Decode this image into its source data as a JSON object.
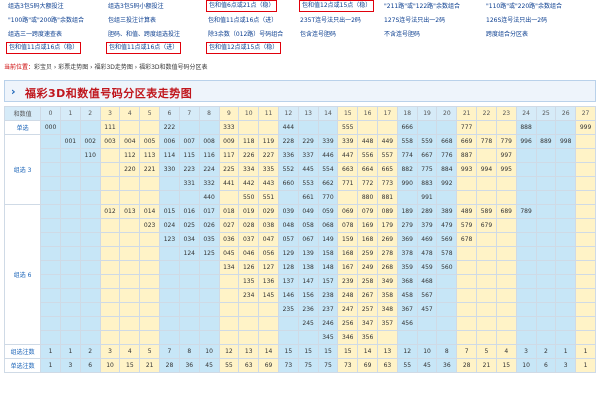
{
  "links": {
    "row1": [
      "组选3包5码大额投注",
      "组选3包5码小额投注",
      "包和值6点或21点（稳）",
      "包和值12点或15点（稳）",
      "\"211路\"或\"122路\"余数组合",
      "\"110路\"或\"220路\"余数组合"
    ],
    "row2": [
      "\"100路\"或\"200路\"余数组合",
      "包组三投注计算表",
      "包和值11点或16点（进）",
      "235T连号法只出一2码",
      "127S连号法只出一2码",
      "126S连号法只出一2码"
    ],
    "row3": [
      "组选三一跨度速查表",
      "胆码、和值、跨度组选投注",
      "除3余数（012路）号码组合",
      "包含连号胆码",
      "不含连号胆码",
      "跨度组合分区表"
    ],
    "row4": [
      "包和值11点或16点（稳）",
      "包和值11点或16点（进）",
      "包和值12点或15点（稳）"
    ]
  },
  "breadcrumb": {
    "label": "当前位置：",
    "path": "彩宝贝 › 彩票走势图 › 福彩3D走势图 › 福彩3D和数值号码分区表"
  },
  "title": "福彩3D和数值号码分区表走势图",
  "table": {
    "header_label": "和数值",
    "sums": [
      "0",
      "1",
      "2",
      "3",
      "4",
      "5",
      "6",
      "7",
      "8",
      "9",
      "10",
      "11",
      "12",
      "13",
      "14",
      "15",
      "16",
      "17",
      "18",
      "19",
      "20",
      "21",
      "22",
      "23",
      "24",
      "25",
      "26",
      "27"
    ],
    "danxuan_label": "单选",
    "danxuan": [
      "000",
      "",
      "",
      "111",
      "",
      "",
      "222",
      "",
      "",
      "333",
      "",
      "",
      "444",
      "",
      "",
      "555",
      "",
      "",
      "666",
      "",
      "",
      "777",
      "",
      "",
      "888",
      "",
      "",
      "999"
    ],
    "group3_label": "组选 3",
    "group3": [
      [
        "",
        "001",
        "002",
        "003",
        "004",
        "005",
        "006",
        "007",
        "008",
        "009",
        "118",
        "119",
        "228",
        "229",
        "339",
        "339",
        "448",
        "449",
        "558",
        "559",
        "668",
        "669",
        "778",
        "779",
        "996",
        "889",
        "998",
        ""
      ],
      [
        "",
        "",
        "110",
        "",
        "112",
        "113",
        "114",
        "115",
        "116",
        "117",
        "226",
        "227",
        "336",
        "337",
        "446",
        "447",
        "556",
        "557",
        "774",
        "667",
        "776",
        "887",
        "",
        "997",
        "",
        "",
        "",
        ""
      ],
      [
        "",
        "",
        "",
        "",
        "220",
        "221",
        "330",
        "223",
        "224",
        "225",
        "334",
        "335",
        "552",
        "445",
        "554",
        "663",
        "664",
        "665",
        "882",
        "775",
        "884",
        "993",
        "994",
        "995",
        "",
        "",
        "",
        ""
      ],
      [
        "",
        "",
        "",
        "",
        "",
        "",
        "",
        "331",
        "332",
        "441",
        "442",
        "443",
        "660",
        "553",
        "662",
        "771",
        "772",
        "773",
        "990",
        "883",
        "992",
        "",
        "",
        "",
        "",
        "",
        "",
        ""
      ],
      [
        "",
        "",
        "",
        "",
        "",
        "",
        "",
        "",
        "440",
        "",
        "550",
        "551",
        "",
        "661",
        "770",
        "",
        "880",
        "881",
        "",
        "991",
        "",
        "",
        "",
        "",
        "",
        "",
        "",
        ""
      ]
    ],
    "group6_label": "组选 6",
    "group6": [
      [
        "",
        "",
        "",
        "012",
        "013",
        "014",
        "015",
        "016",
        "017",
        "018",
        "019",
        "029",
        "039",
        "049",
        "059",
        "069",
        "079",
        "089",
        "189",
        "289",
        "389",
        "489",
        "589",
        "689",
        "789",
        "",
        "",
        ""
      ],
      [
        "",
        "",
        "",
        "",
        "",
        "023",
        "024",
        "025",
        "026",
        "027",
        "028",
        "038",
        "048",
        "058",
        "068",
        "078",
        "169",
        "179",
        "279",
        "379",
        "479",
        "579",
        "679",
        "",
        "",
        "",
        "",
        ""
      ],
      [
        "",
        "",
        "",
        "",
        "",
        "",
        "123",
        "034",
        "035",
        "036",
        "037",
        "047",
        "057",
        "067",
        "149",
        "159",
        "168",
        "269",
        "369",
        "469",
        "569",
        "678",
        "",
        "",
        "",
        "",
        "",
        ""
      ],
      [
        "",
        "",
        "",
        "",
        "",
        "",
        "",
        "124",
        "125",
        "045",
        "046",
        "056",
        "129",
        "139",
        "158",
        "168",
        "259",
        "278",
        "378",
        "478",
        "578",
        "",
        "",
        "",
        "",
        "",
        "",
        ""
      ],
      [
        "",
        "",
        "",
        "",
        "",
        "",
        "",
        "",
        "",
        "134",
        "126",
        "127",
        "128",
        "138",
        "148",
        "167",
        "249",
        "268",
        "359",
        "459",
        "560",
        "",
        "",
        "",
        "",
        "",
        "",
        ""
      ],
      [
        "",
        "",
        "",
        "",
        "",
        "",
        "",
        "",
        "",
        "",
        "135",
        "136",
        "137",
        "147",
        "157",
        "239",
        "258",
        "349",
        "368",
        "468",
        "",
        "",
        "",
        "",
        "",
        "",
        "",
        ""
      ],
      [
        "",
        "",
        "",
        "",
        "",
        "",
        "",
        "",
        "",
        "",
        "234",
        "145",
        "146",
        "156",
        "238",
        "248",
        "267",
        "358",
        "458",
        "567",
        "",
        "",
        "",
        "",
        "",
        "",
        "",
        ""
      ],
      [
        "",
        "",
        "",
        "",
        "",
        "",
        "",
        "",
        "",
        "",
        "",
        "",
        "235",
        "236",
        "237",
        "247",
        "257",
        "348",
        "367",
        "457",
        "",
        "",
        "",
        "",
        "",
        "",
        "",
        ""
      ],
      [
        "",
        "",
        "",
        "",
        "",
        "",
        "",
        "",
        "",
        "",
        "",
        "",
        "",
        "245",
        "246",
        "256",
        "347",
        "357",
        "456",
        "",
        "",
        "",
        "",
        "",
        "",
        "",
        "",
        ""
      ],
      [
        "",
        "",
        "",
        "",
        "",
        "",
        "",
        "",
        "",
        "",
        "",
        "",
        "",
        "",
        "345",
        "346",
        "356",
        "",
        "",
        "",
        "",
        "",
        "",
        "",
        "",
        "",
        "",
        ""
      ]
    ],
    "zuxuan_label": "组选注数",
    "zuxuan": [
      "1",
      "1",
      "2",
      "3",
      "4",
      "5",
      "7",
      "8",
      "10",
      "12",
      "13",
      "14",
      "15",
      "15",
      "15",
      "15",
      "14",
      "13",
      "12",
      "10",
      "8",
      "7",
      "5",
      "4",
      "3",
      "2",
      "1",
      "1"
    ],
    "danxuan_count_label": "单选注数",
    "danxuan_count": [
      "1",
      "3",
      "6",
      "10",
      "15",
      "21",
      "28",
      "36",
      "45",
      "55",
      "63",
      "69",
      "73",
      "75",
      "75",
      "73",
      "69",
      "63",
      "55",
      "45",
      "36",
      "28",
      "21",
      "15",
      "10",
      "6",
      "3",
      "1"
    ]
  }
}
